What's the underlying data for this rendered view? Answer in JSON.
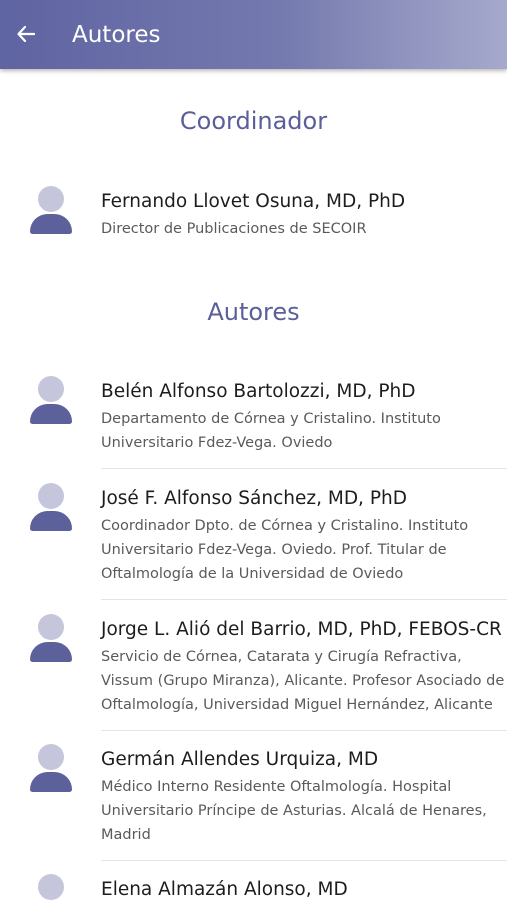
{
  "appbar": {
    "title": "Autores",
    "back_icon": "arrow-left-icon"
  },
  "sections": {
    "coordinator_title": "Coordinador",
    "authors_title": "Autores"
  },
  "coordinator": {
    "name": "Fernando Llovet Osuna, MD, PhD",
    "desc_lines": [
      "Director de Publicaciones de SECOIR"
    ]
  },
  "authors": [
    {
      "name": "Belén Alfonso Bartolozzi, MD, PhD",
      "desc_lines": [
        "Departamento de Córnea y Cristalino. Instituto",
        "Universitario Fdez-Vega. Oviedo"
      ]
    },
    {
      "name": "José F. Alfonso Sánchez, MD, PhD",
      "desc_lines": [
        "Coordinador Dpto. de Córnea y Cristalino. Instituto",
        "Universitario Fdez-Vega. Oviedo. Prof. Titular de",
        "Oftalmología de la Universidad de Oviedo"
      ]
    },
    {
      "name": "Jorge L. Alió del Barrio, MD, PhD, FEBOS-CR",
      "desc_lines": [
        "Servicio de Córnea, Catarata y Cirugía Refractiva,",
        "Vissum (Grupo Miranza), Alicante. Profesor Asociado de",
        "Oftalmología, Universidad Miguel Hernández, Alicante"
      ]
    },
    {
      "name": "Germán Allendes Urquiza, MD",
      "desc_lines": [
        "Médico Interno Residente Oftalmología. Hospital",
        "Universitario Príncipe de Asturias. Alcalá de Henares,",
        "Madrid"
      ]
    },
    {
      "name": "Elena Almazán Alonso, MD",
      "desc_lines": []
    }
  ],
  "colors": {
    "appbar_start": "#5f64a2",
    "appbar_end": "#a6a9cc",
    "section_title": "#5b5f99",
    "avatar_head": "#c5c6dc",
    "avatar_body": "#5d619b"
  }
}
